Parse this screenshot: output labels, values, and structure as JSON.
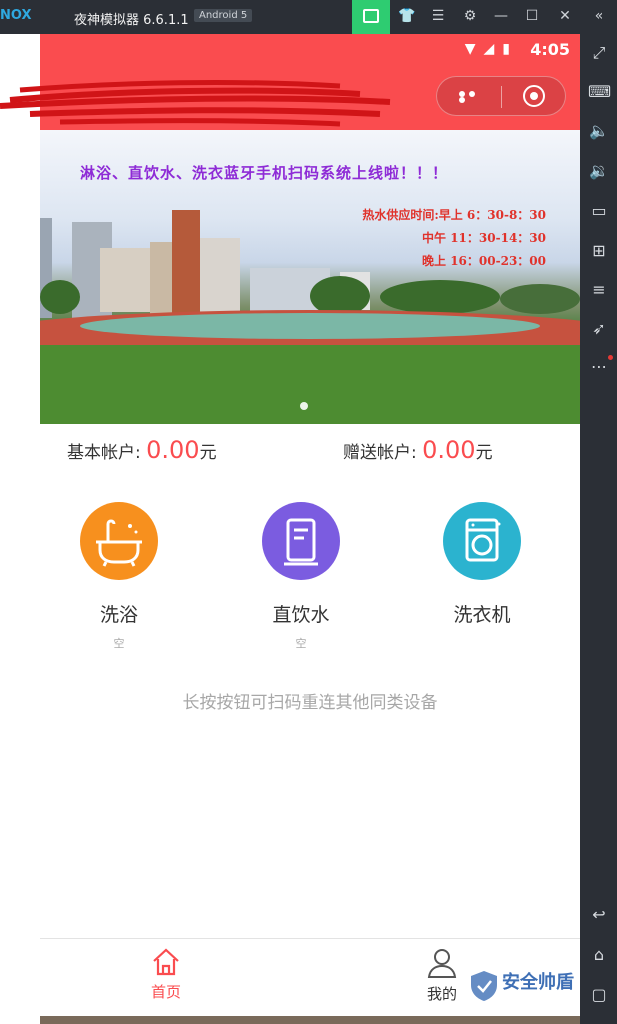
{
  "emulator": {
    "logo_text": "NOX",
    "title": "夜神模拟器 6.6.1.1",
    "android_badge": "Android 5",
    "controls": [
      "shirt-icon",
      "menu-icon",
      "gear-icon",
      "minimize-icon",
      "maximize-icon",
      "close-icon",
      "collapse-icon"
    ],
    "sidebar_icons": [
      "fullscreen-icon",
      "keyboard-icon",
      "volume-up-icon",
      "volume-down-icon",
      "screen-icon",
      "apk-icon",
      "stack-icon",
      "rocket-icon",
      "more-icon",
      "back-icon",
      "home-icon",
      "recent-apps-icon"
    ]
  },
  "status_bar": {
    "time": "4:05"
  },
  "banner": {
    "headline": "淋浴、直饮水、洗衣蓝牙手机扫码系统上线啦！！！",
    "hours": [
      "热水供应时间:早上 6：30-8：30",
      "中午 11：30-14：30",
      "晚上 16：00-23：00"
    ]
  },
  "accounts": {
    "basic_label": "基本帐户:",
    "basic_amount": "0.00",
    "basic_unit": "元",
    "gift_label": "赠送帐户:",
    "gift_amount": "0.00",
    "gift_unit": "元"
  },
  "services": [
    {
      "label": "洗浴",
      "state": "空",
      "icon": "bathtub-icon",
      "color": "#f7901e"
    },
    {
      "label": "直饮水",
      "state": "空",
      "icon": "water-dispenser-icon",
      "color": "#7b5ce0"
    },
    {
      "label": "洗衣机",
      "state": "",
      "icon": "washing-machine-icon",
      "color": "#2bb3cf"
    }
  ],
  "hint": "长按按钮可扫码重连其他同类设备",
  "nav": {
    "home": "首页",
    "mine": "我的"
  },
  "watermark": "安全帅盾",
  "colors": {
    "brand_red": "#fa4c4f",
    "emulator_dark": "#2b2f36"
  }
}
